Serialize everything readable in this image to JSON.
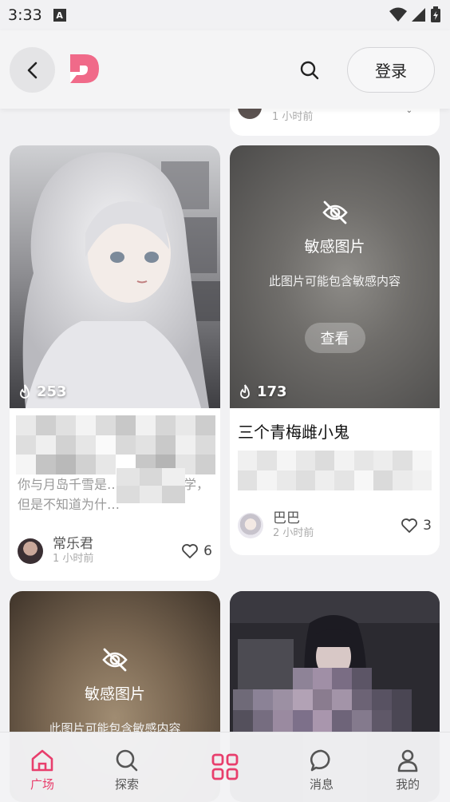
{
  "status_bar": {
    "time": "3:33",
    "notification_letter": "A"
  },
  "header": {
    "login_label": "登录"
  },
  "colors": {
    "accent": "#e83e6c",
    "background": "#f1f1f3",
    "card": "#ffffff"
  },
  "top_right_card": {
    "time": "1 小时前"
  },
  "cards": [
    {
      "heat": "253",
      "description": "你与月岛千雪是…研究社的同学，但是不知道为什…",
      "author": "常乐君",
      "time": "1 小时前",
      "likes": "6"
    },
    {
      "heat": "173",
      "title": "三个青梅雌小鬼",
      "sensitive_title": "敏感图片",
      "sensitive_subtitle": "此图片可能包含敏感内容",
      "view_label": "查看",
      "author": "巴巴",
      "time": "2 小时前",
      "likes": "3"
    },
    {
      "sensitive_title": "敏感图片",
      "sensitive_subtitle": "此图片可能包含敏感内容"
    }
  ],
  "bottom_nav": [
    {
      "label": "广场",
      "icon": "home-icon",
      "active": true
    },
    {
      "label": "探索",
      "icon": "search-icon",
      "active": false
    },
    {
      "label": "",
      "icon": "grid-icon",
      "active": false
    },
    {
      "label": "消息",
      "icon": "chat-bubble-icon",
      "active": false
    },
    {
      "label": "我的",
      "icon": "user-icon",
      "active": false
    }
  ]
}
